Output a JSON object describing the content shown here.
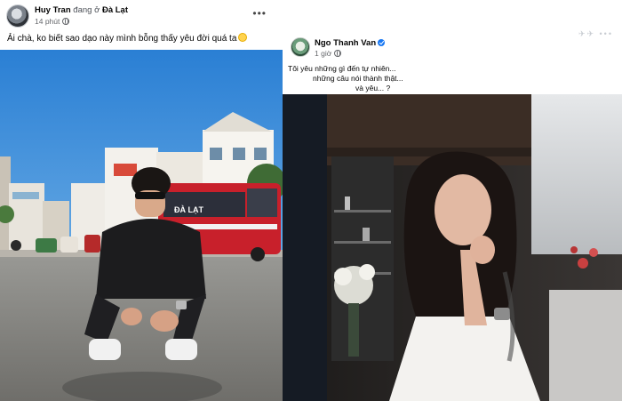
{
  "left_post": {
    "author": "Huy Tran",
    "checkin_text": "đang ở",
    "location": "Đà Lạt",
    "time": "14 phút",
    "status": "Ải chà, ko biết sao dạo này mình bỗng thấy yêu đời quá ta",
    "photo": {
      "sign_text": "ĐÀ LẠT"
    }
  },
  "right_post": {
    "author": "Ngo Thanh Van",
    "time": "1 giờ",
    "status_lines": [
      "Tôi yêu những gì đến tự nhiên...",
      "những câu nói thành thật...",
      "và yêu... ?"
    ]
  },
  "icons": {
    "globe": "globe-icon",
    "more": "more-options-icon",
    "verified": "verified-badge-icon",
    "emoji": "smile-emoji-icon"
  },
  "colors": {
    "name_text": "#050505",
    "meta_text": "#65676b",
    "verified": "#1877f2",
    "bus_red": "#c8202b",
    "sky_blue": "#3f8fd6"
  }
}
